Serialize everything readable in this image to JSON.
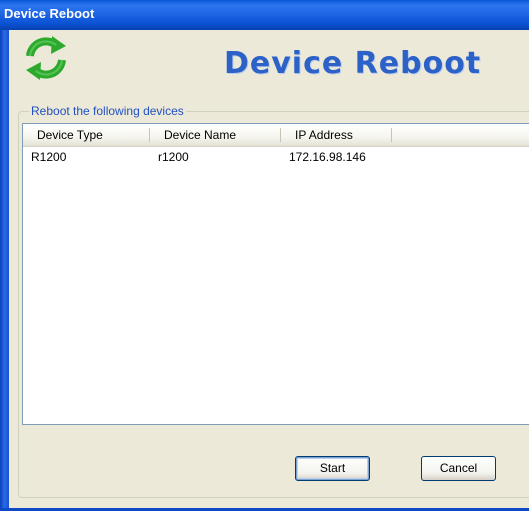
{
  "window": {
    "title": "Device Reboot"
  },
  "header": {
    "banner_text": "Device Reboot",
    "logo_icon": "refresh-arrows-icon",
    "accent_color": "#2C61C7",
    "logo_color": "#2DAA2D"
  },
  "group": {
    "label": "Reboot the following devices"
  },
  "table": {
    "columns": [
      "Device Type",
      "Device Name",
      "IP Address"
    ],
    "rows": [
      [
        "R1200",
        "r1200",
        "172.16.98.146"
      ]
    ]
  },
  "buttons": {
    "start_label": "Start",
    "cancel_label": "Cancel"
  }
}
